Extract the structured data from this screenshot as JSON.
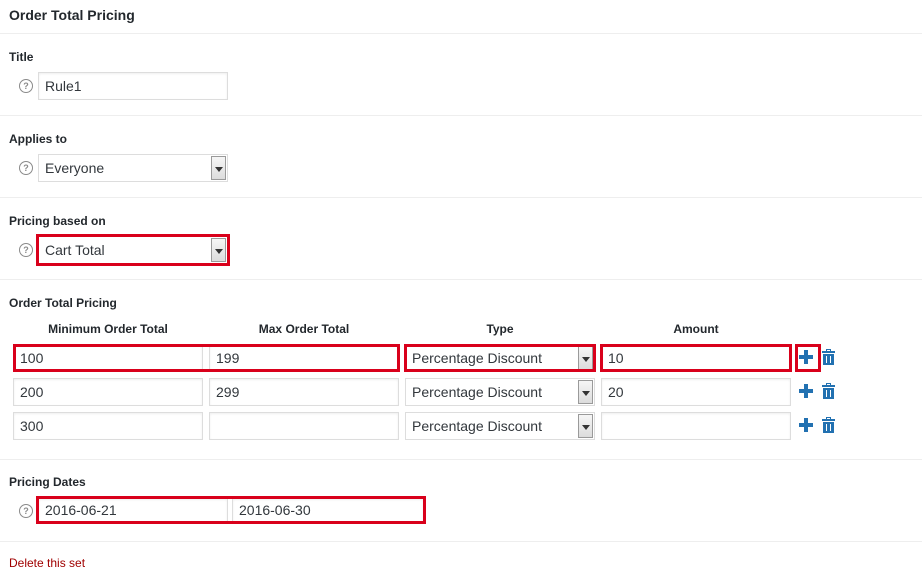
{
  "header": {
    "title": "Order Total Pricing"
  },
  "title_section": {
    "label": "Title",
    "value": "Rule1"
  },
  "applies_to": {
    "label": "Applies to",
    "selected": "Everyone"
  },
  "pricing_based_on": {
    "label": "Pricing based on",
    "selected": "Cart Total"
  },
  "order_total_pricing": {
    "label": "Order Total Pricing",
    "columns": [
      "Minimum Order Total",
      "Max Order Total",
      "Type",
      "Amount"
    ],
    "rows": [
      {
        "min": "100",
        "max": "199",
        "type": "Percentage Discount",
        "amount": "10"
      },
      {
        "min": "200",
        "max": "299",
        "type": "Percentage Discount",
        "amount": "20"
      },
      {
        "min": "300",
        "max": "",
        "type": "Percentage Discount",
        "amount": ""
      }
    ]
  },
  "pricing_dates": {
    "label": "Pricing Dates",
    "from": "2016-06-21",
    "to": "2016-06-30"
  },
  "delete_label": "Delete this set",
  "help_glyph": "?",
  "icons": {
    "help": "question-circle-icon",
    "add": "plus-icon",
    "delete": "trash-icon"
  },
  "colors": {
    "highlight": "#d9001b",
    "link": "#2271b1",
    "delete_link": "#a00000"
  }
}
